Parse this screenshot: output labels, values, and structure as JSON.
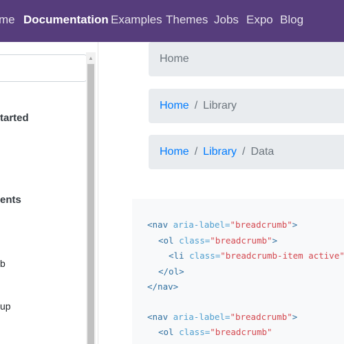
{
  "navbar": {
    "items": [
      {
        "label": "me"
      },
      {
        "label": "Documentation"
      },
      {
        "label": "Examples"
      },
      {
        "label": "Themes"
      },
      {
        "label": "Jobs"
      },
      {
        "label": "Expo"
      },
      {
        "label": "Blog"
      }
    ]
  },
  "sidebar": {
    "search": {
      "value": "",
      "placeholder": ""
    },
    "items": [
      {
        "label": "tarted"
      },
      {
        "label": "ents"
      },
      {
        "label": "b"
      },
      {
        "label": "up"
      }
    ]
  },
  "breadcrumbs": [
    {
      "items": [
        "Home"
      ]
    },
    {
      "items": [
        "Home",
        "Library"
      ]
    },
    {
      "items": [
        "Home",
        "Library",
        "Data"
      ]
    }
  ],
  "code": {
    "nav_open": "<nav",
    "aria_attr": "aria-label=",
    "aria_val": "\"breadcrumb\"",
    "gt": ">",
    "ol_open": "<ol",
    "class_attr": "class=",
    "ol_class_val": "\"breadcrumb\"",
    "li_open": "<li",
    "li_class_val": "\"breadcrumb-item active\"",
    "ol_close": "</ol>",
    "nav_close": "</nav>"
  },
  "colors": {
    "navbar": "#563d7c",
    "link": "#007bff",
    "breadcrumb_bg": "#e9ecef",
    "code_bg": "#f8f9fa"
  }
}
